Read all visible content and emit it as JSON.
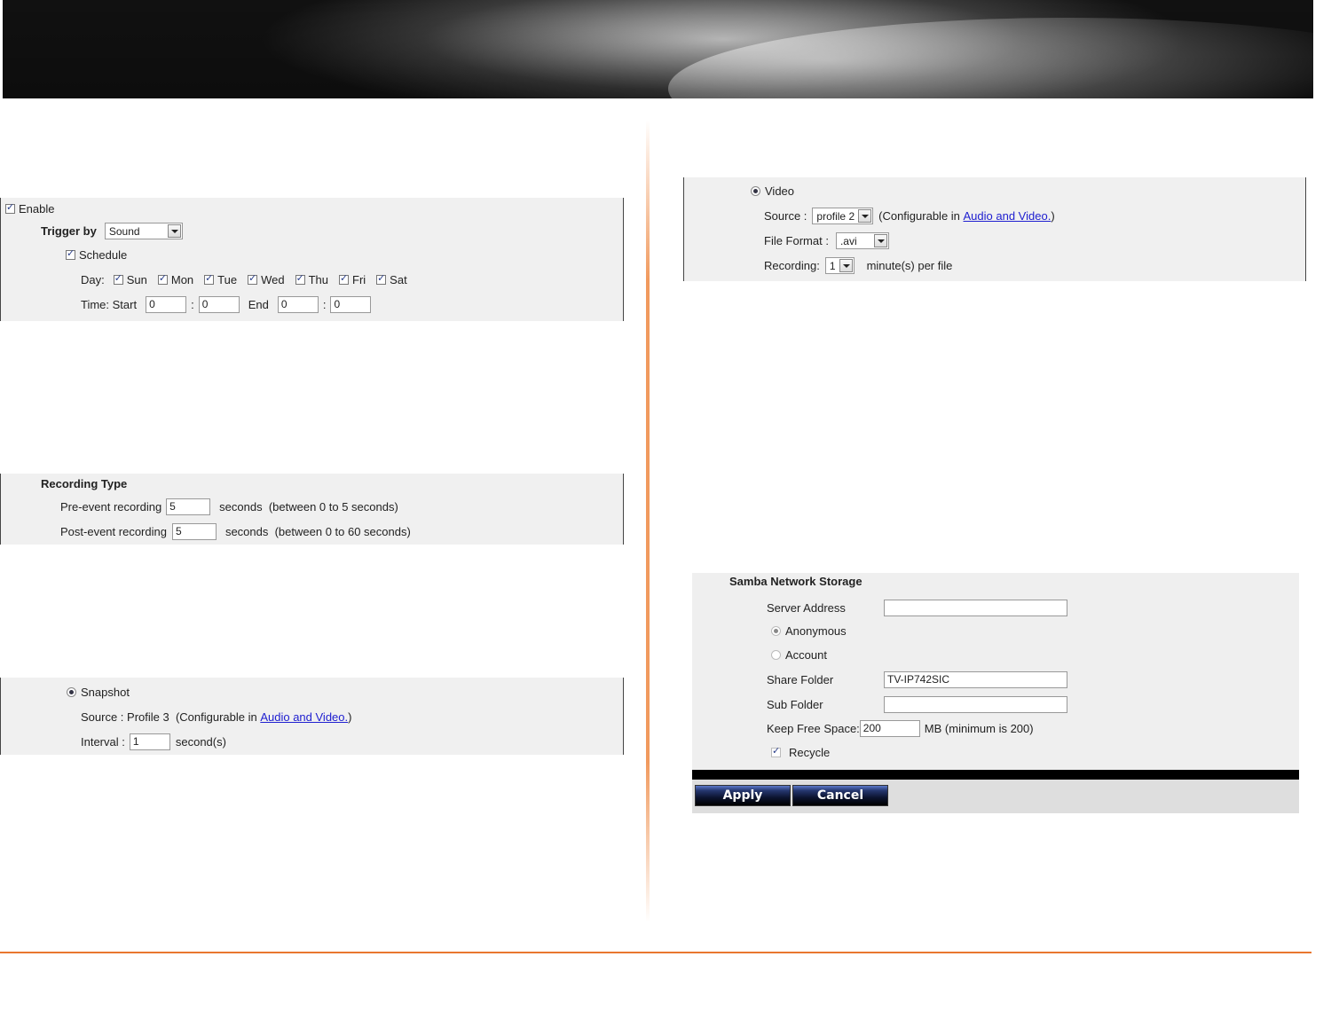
{
  "event_trigger": {
    "enable_label": "Enable",
    "enable_checked": true,
    "trigger_by_label": "Trigger by",
    "trigger_by_value": "Sound",
    "schedule_label": "Schedule",
    "schedule_checked": true,
    "day_label": "Day:",
    "days": [
      {
        "label": "Sun",
        "checked": true
      },
      {
        "label": "Mon",
        "checked": true
      },
      {
        "label": "Tue",
        "checked": true
      },
      {
        "label": "Wed",
        "checked": true
      },
      {
        "label": "Thu",
        "checked": true
      },
      {
        "label": "Fri",
        "checked": true
      },
      {
        "label": "Sat",
        "checked": true
      }
    ],
    "time_start_label": "Time: Start",
    "start_hour": "0",
    "colon": ":",
    "start_minute": "0",
    "end_label": "End",
    "end_hour": "0",
    "end_minute": "0"
  },
  "recording_type": {
    "title": "Recording Type",
    "pre_label": "Pre-event recording",
    "pre_value": "5",
    "pre_suffix": "seconds  (between 0 to 5 seconds)",
    "post_label": "Post-event recording",
    "post_value": "5",
    "post_suffix": "seconds  (between 0 to 60 seconds)"
  },
  "snapshot": {
    "label": "Snapshot",
    "selected": true,
    "source_text": "Source : Profile 3  (Configurable in ",
    "link_text": "Audio and Video.",
    "close_paren": ")",
    "interval_label": "Interval :",
    "interval_value": "1",
    "interval_unit": "second(s)"
  },
  "video": {
    "label": "Video",
    "selected": true,
    "source_label": "Source :",
    "source_value": "profile 2",
    "config_prefix": "(Configurable in ",
    "link_text": "Audio and Video.",
    "close_paren": ")",
    "file_format_label": "File Format :",
    "file_format_value": ".avi",
    "recording_label": "Recording:",
    "recording_value": "1",
    "recording_unit": "minute(s) per file"
  },
  "samba": {
    "title": "Samba Network Storage",
    "server_address_label": "Server Address",
    "server_address_value": "",
    "anonymous_label": "Anonymous",
    "account_label": "Account",
    "share_folder_label": "Share Folder",
    "share_folder_value": "TV-IP742SIC",
    "sub_folder_label": "Sub Folder",
    "sub_folder_value": "",
    "keep_free_label": "Keep Free Space:",
    "keep_free_value": "200",
    "keep_free_unit": "MB (minimum is 200)",
    "recycle_label": "Recycle",
    "recycle_checked": true,
    "apply_label": "Apply",
    "cancel_label": "Cancel"
  }
}
